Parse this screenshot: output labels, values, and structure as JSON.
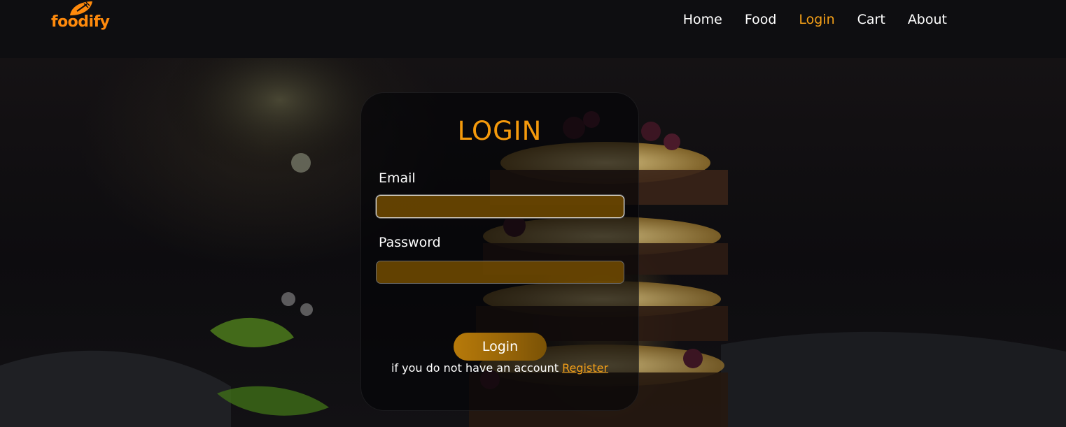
{
  "brand": {
    "name": "foodify",
    "logo_icon": "leaf-fork-icon"
  },
  "nav": {
    "items": [
      {
        "label": "Home",
        "active": false
      },
      {
        "label": "Food",
        "active": false
      },
      {
        "label": "Login",
        "active": true
      },
      {
        "label": "Cart",
        "active": false
      },
      {
        "label": "About",
        "active": false
      }
    ]
  },
  "login": {
    "title": "LOGIN",
    "email_label": "Email",
    "email_value": "",
    "password_label": "Password",
    "password_value": "",
    "submit_label": "Login",
    "register_prompt": "if you do not have an account",
    "register_link": "Register"
  },
  "colors": {
    "accent": "#f59a0c",
    "nav_active": "#f5a018",
    "input_fill": "#764e00",
    "background": "#0c0c0f"
  }
}
